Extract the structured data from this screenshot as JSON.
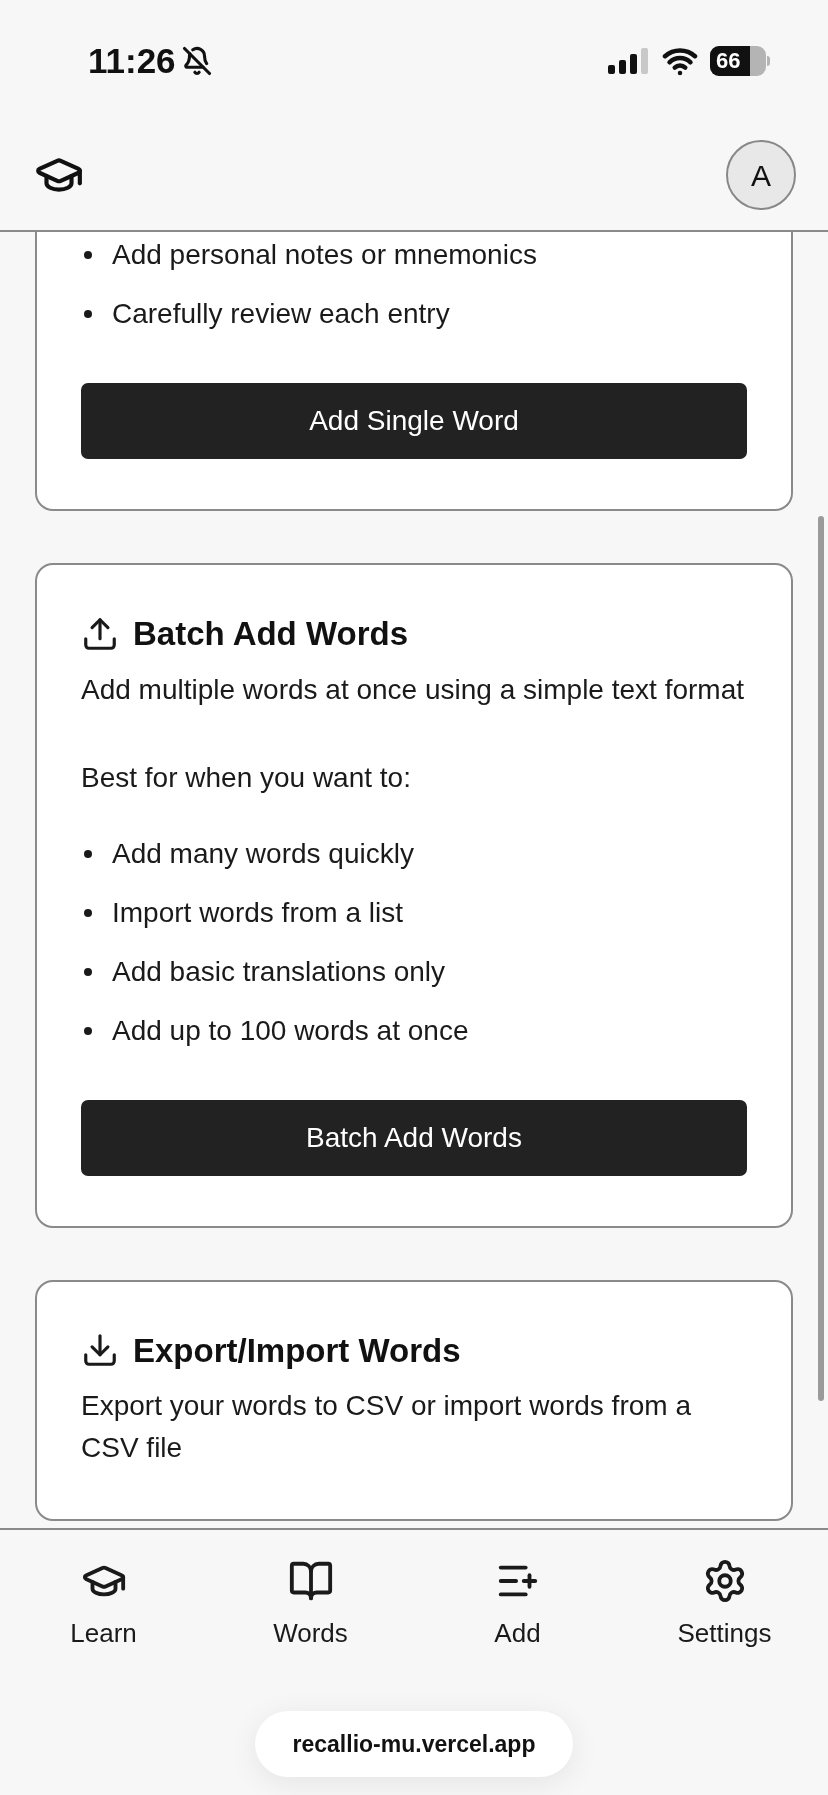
{
  "status_bar": {
    "time": "11:26",
    "battery": "66"
  },
  "header": {
    "avatar": "A"
  },
  "cards": [
    {
      "bullets": [
        "Add personal notes or mnemonics",
        "Carefully review each entry"
      ],
      "button": "Add Single Word"
    },
    {
      "title": "Batch Add Words",
      "description": "Add multiple words at once using a simple text format",
      "intro": "Best for when you want to:",
      "bullets": [
        "Add many words quickly",
        "Import words from a list",
        "Add basic translations only",
        "Add up to 100 words at once"
      ],
      "button": "Batch Add Words"
    },
    {
      "title": "Export/Import Words",
      "description": "Export your words to CSV or import words from a CSV file"
    }
  ],
  "nav": [
    {
      "label": "Learn"
    },
    {
      "label": "Words"
    },
    {
      "label": "Add"
    },
    {
      "label": "Settings"
    }
  ],
  "url": "recallio-mu.vercel.app"
}
